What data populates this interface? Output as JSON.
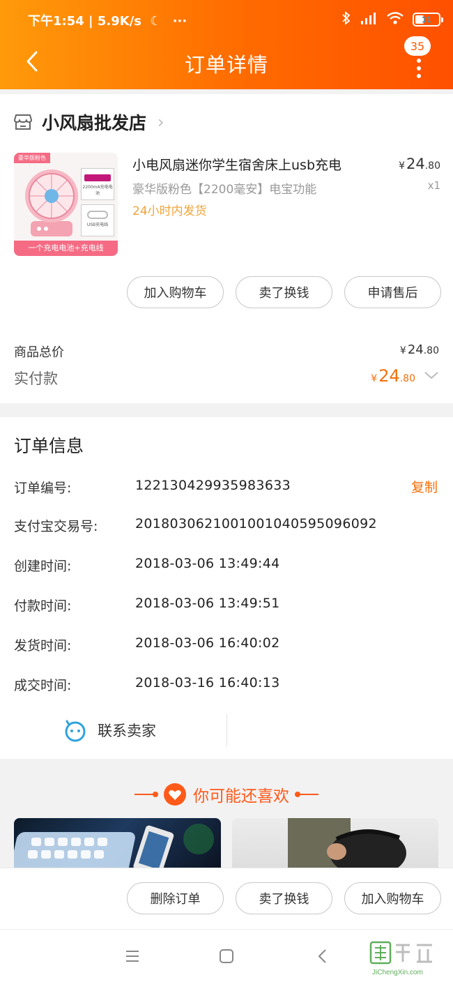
{
  "status_bar": {
    "left_text": "下午1:54 | 5.9K/s",
    "battery": "11"
  },
  "header": {
    "title": "订单详情",
    "badge_count": "35"
  },
  "shop": {
    "name": "小风扇批发店"
  },
  "product": {
    "image_tag": "豪华版粉色",
    "image_caption": "一个充电电池+充电线",
    "image_acc1": "2200mA充电电池",
    "image_acc2": "USB充电线",
    "name": "小电风扇迷你学生宿舍床上usb充电",
    "spec": "豪华版粉色【2200毫安】电宝功能",
    "shipping": "24小时内发货",
    "price_symbol": "¥",
    "price_int": "24",
    "price_dec": ".80",
    "quantity": "x1"
  },
  "product_buttons": [
    "加入购物车",
    "卖了换钱",
    "申请售后"
  ],
  "summary": {
    "total_label": "商品总价",
    "total_symbol": "¥",
    "total_int": "24",
    "total_dec": ".80",
    "paid_label": "实付款",
    "paid_symbol": "¥",
    "paid_int": "24",
    "paid_dec": ".80"
  },
  "order_info": {
    "title": "订单信息",
    "copy_label": "复制",
    "rows": [
      {
        "label": "订单编号:",
        "value": "122130429935983633"
      },
      {
        "label": "支付宝交易号:",
        "value": "2018030621001001040595096092"
      },
      {
        "label": "创建时间:",
        "value": "2018-03-06 13:49:44"
      },
      {
        "label": "付款时间:",
        "value": "2018-03-06 13:49:51"
      },
      {
        "label": "发货时间:",
        "value": "2018-03-06 16:40:02"
      },
      {
        "label": "成交时间:",
        "value": "2018-03-16 16:40:13"
      }
    ],
    "contact_label": "联系卖家"
  },
  "recommend": {
    "title": "你可能还喜欢"
  },
  "bottom_buttons": [
    "删除订单",
    "卖了换钱",
    "加入购物车"
  ],
  "colors": {
    "accent": "#ff6a00",
    "price": "#f2700a",
    "shipping": "#f0a43a"
  }
}
